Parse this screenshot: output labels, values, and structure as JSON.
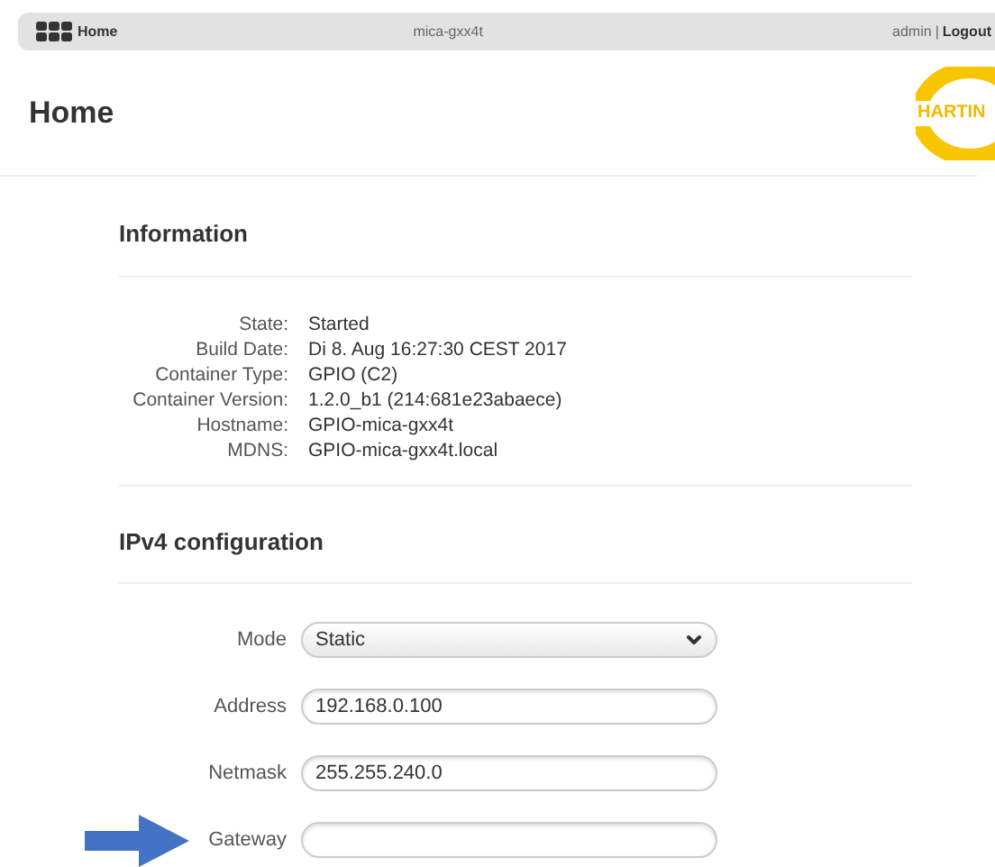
{
  "topbar": {
    "home": "Home",
    "host": "mica-gxx4t",
    "user": "admin",
    "separator": "|",
    "logout": "Logout"
  },
  "page": {
    "title": "Home",
    "logo": "HARTIN"
  },
  "information": {
    "title": "Information",
    "rows": [
      {
        "label": "State:",
        "value": "Started"
      },
      {
        "label": "Build Date:",
        "value": "Di 8. Aug 16:27:30 CEST 2017"
      },
      {
        "label": "Container Type:",
        "value": "GPIO (C2)"
      },
      {
        "label": "Container Version:",
        "value": "1.2.0_b1 (214:681e23abaece)"
      },
      {
        "label": "Hostname:",
        "value": "GPIO-mica-gxx4t"
      },
      {
        "label": "MDNS:",
        "value": "GPIO-mica-gxx4t.local"
      }
    ]
  },
  "ipv4": {
    "title": "IPv4 configuration",
    "fields": [
      {
        "kind": "select",
        "label": "Mode",
        "value": "Static"
      },
      {
        "kind": "text",
        "label": "Address",
        "value": "192.168.0.100"
      },
      {
        "kind": "text",
        "label": "Netmask",
        "value": "255.255.240.0"
      },
      {
        "kind": "text",
        "label": "Gateway",
        "highlighted": true
      }
    ]
  }
}
